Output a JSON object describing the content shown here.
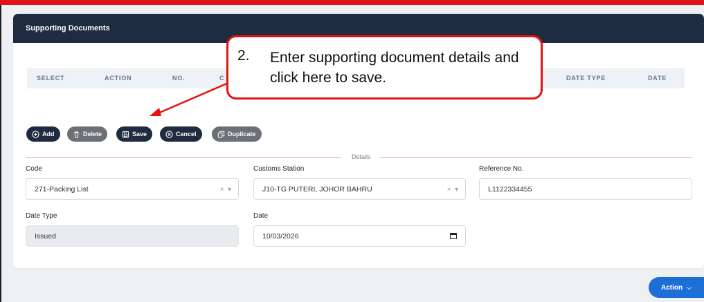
{
  "card": {
    "title": "Supporting Documents"
  },
  "table": {
    "columns": [
      "SELECT",
      "ACTION",
      "NO.",
      "C",
      "DATE TYPE",
      "DATE"
    ]
  },
  "toolbar": {
    "add": "Add",
    "delete": "Delete",
    "save": "Save",
    "cancel": "Cancel",
    "duplicate": "Duplicate"
  },
  "section": {
    "label": "Details"
  },
  "form": {
    "code_label": "Code",
    "code_value": "271-Packing List",
    "station_label": "Customs Station",
    "station_value": "J10-TG PUTERI, JOHOR BAHRU",
    "ref_label": "Reference No.",
    "ref_value": "L1122334455",
    "datetype_label": "Date Type",
    "datetype_value": "Issued",
    "date_label": "Date",
    "date_value": "10/03/2026"
  },
  "action": {
    "label": "Action"
  },
  "callout": {
    "number": "2.",
    "text": "Enter supporting document details and click here to save."
  },
  "colors": {
    "header": "#1f2b3f",
    "annotation": "#e1140f",
    "accent": "#1d6fd8"
  }
}
